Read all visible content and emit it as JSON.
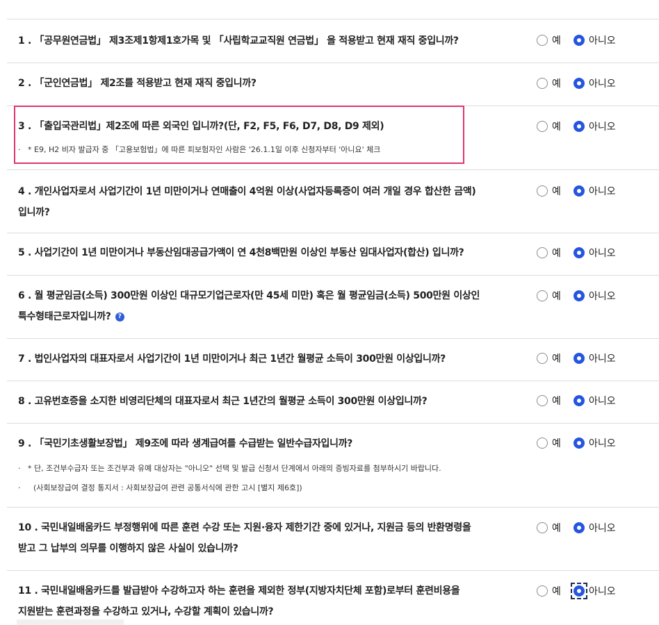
{
  "options": {
    "yes": "예",
    "no": "아니오"
  },
  "questions": [
    {
      "lines": [
        "1 . 「공무원연금법」 제3조제1항제1호가목 및 「사립학교교직원 연금법」 을 적용받고 현재 재직 중입니까?"
      ],
      "selected": "no"
    },
    {
      "lines": [
        "2 . 「군인연금법」 제2조를 적용받고 현재 재직 중입니까?"
      ],
      "selected": "no"
    },
    {
      "lines": [
        "3 . 「출입국관리법」제2조에 따른 외국인 입니까?(단, F2, F5, F6, D7, D8, D9 제외)"
      ],
      "selected": "no",
      "notes": [
        "* E9, H2 비자 발급자 중 「고용보험법」에 따른 피보험자인 사람은 '26.1.1일 이후 신청자부터 '아니요' 체크"
      ]
    },
    {
      "lines": [
        "4 . 개인사업자로서 사업기간이 1년 미만이거나 연매출이 4억원 이상(사업자등록증이 여러 개일 경우 합산한 금액)",
        "입니까?"
      ],
      "selected": "no"
    },
    {
      "lines": [
        "5 . 사업기간이 1년 미만이거나 부동산임대공급가액이 연 4천8백만원 이상인 부동산 임대사업자(합산) 입니까?"
      ],
      "selected": "no"
    },
    {
      "lines": [
        "6 . 월 평균임금(소득) 300만원 이상인 대규모기업근로자(만 45세 미만) 혹은 월 평균임금(소득) 500만원 이상인",
        "특수형태근로자입니까?"
      ],
      "selected": "no",
      "help_icon": "?"
    },
    {
      "lines": [
        "7 . 법인사업자의 대표자로서 사업기간이 1년 미만이거나 최근 1년간 월평균 소득이 300만원 이상입니까?"
      ],
      "selected": "no"
    },
    {
      "lines": [
        "8 . 고유번호증을 소지한 비영리단체의 대표자로서 최근 1년간의 월평균 소득이 300만원 이상입니까?"
      ],
      "selected": "no"
    },
    {
      "lines": [
        "9 . 「국민기초생활보장법」 제9조에 따라 생계급여를 수급받는 일반수급자입니까?"
      ],
      "selected": "no",
      "notes": [
        "* 단, 조건부수급자 또는 조건부과 유예 대상자는 \"아니오\" 선택 및 발급 신청서 단계에서 아래의 증빙자료를 첨부하시기 바랍니다.",
        "(사회보장급여 결정 통지서 : 사회보장급여 관련 공통서식에 관한 고시 [별지 제6호])"
      ]
    },
    {
      "lines": [
        "10 . 국민내일배움카드 부정행위에 따른 훈련 수강 또는 지원·융자 제한기간 중에 있거나, 지원금 등의 반환명령을",
        "받고 그 납부의 의무를 이행하지 않은 사실이 있습니까?"
      ],
      "selected": "no"
    },
    {
      "lines": [
        "11 . 국민내일배움카드를 발급받아 수강하고자 하는 훈련을 제외한 정부(지방자치단체 포함)로부터 훈련비용을",
        "지원받는 훈련과정을 수강하고 있거나, 수강할 계획이 있습니까?"
      ],
      "selected": "no",
      "focused": true
    }
  ],
  "colors": {
    "radio_selected": "#2555e0",
    "highlight_border": "#e0336e",
    "divider": "#dcdcdc"
  },
  "icons": {
    "help": "help-icon",
    "radio": "radio-icon"
  }
}
